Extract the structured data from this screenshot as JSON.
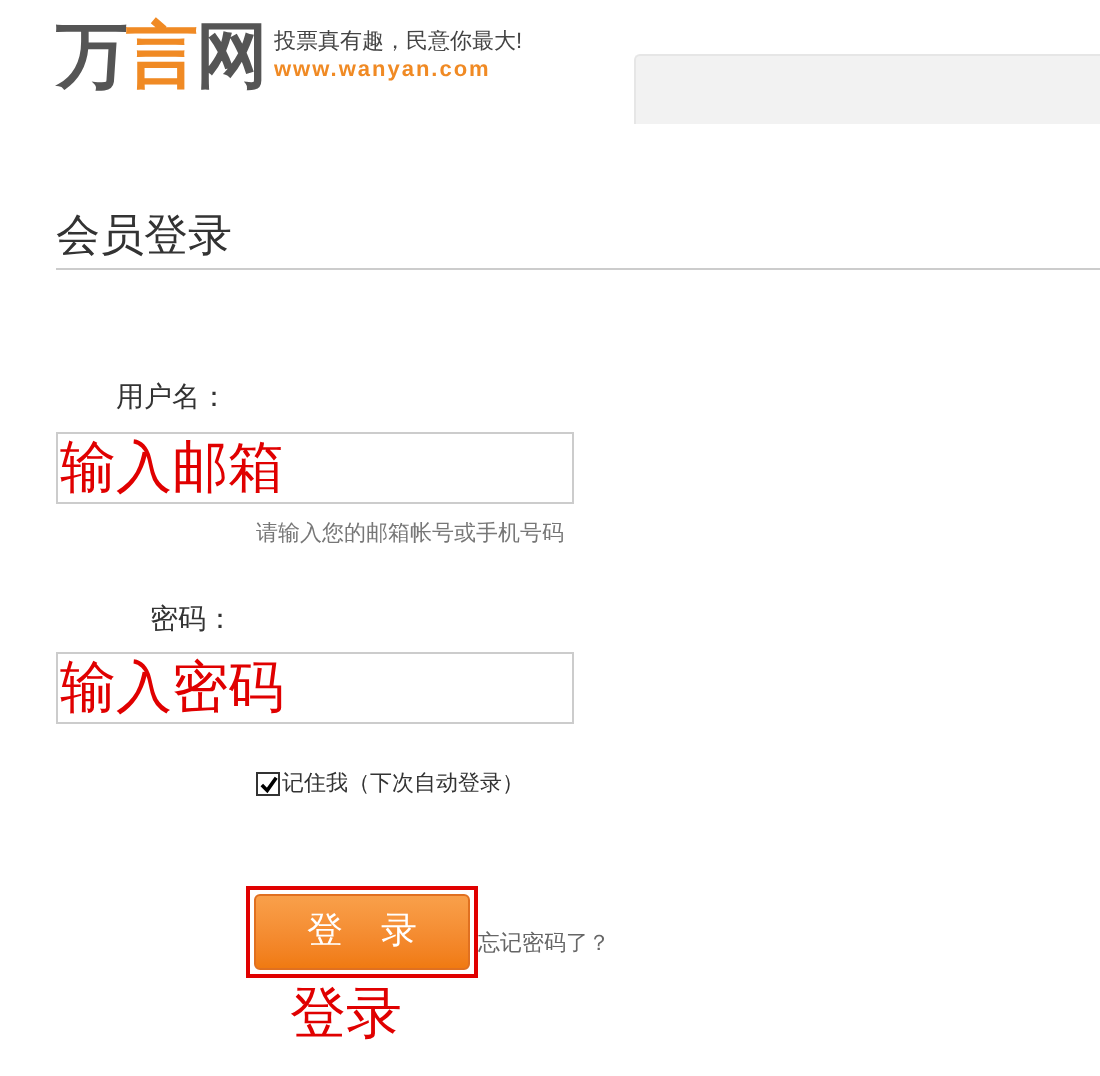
{
  "header": {
    "logo": [
      {
        "text": "万",
        "color": "#555555"
      },
      {
        "text": "言",
        "color": "#f08a24"
      },
      {
        "text": "网",
        "color": "#555555"
      }
    ],
    "slogan": "投票真有趣，民意你最大!",
    "url": "www.wanyan.com"
  },
  "title": "会员登录",
  "username": {
    "label": "用户名：",
    "value": "输入邮箱",
    "hint": "请输入您的邮箱帐号或手机号码"
  },
  "password": {
    "label": "密码：",
    "value": "输入密码"
  },
  "remember": {
    "label": "记住我（下次自动登录）",
    "checked": true
  },
  "login_button": {
    "label": "登 录",
    "highlighted": true
  },
  "forgot_link": "忘记密码了？",
  "annotation": "登录"
}
